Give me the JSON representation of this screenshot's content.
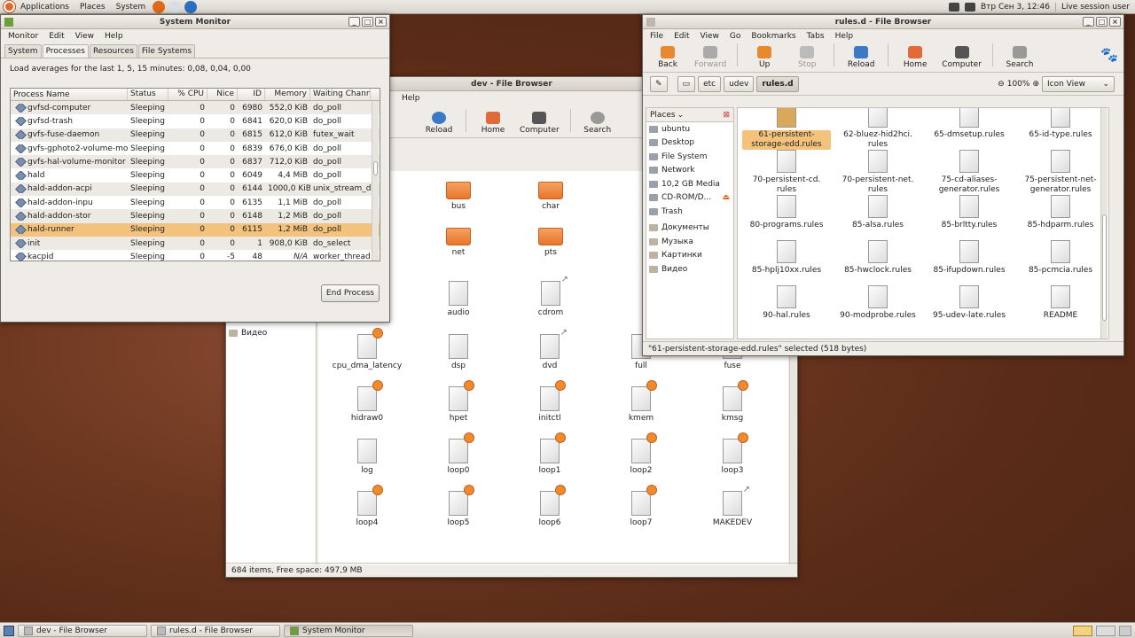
{
  "top_panel": {
    "menus": [
      "Applications",
      "Places",
      "System"
    ],
    "keyboard": "Втр Сен  3, 12:46",
    "session": "Live session user"
  },
  "sysmon": {
    "title": "System Monitor",
    "menus": [
      "Monitor",
      "Edit",
      "View",
      "Help"
    ],
    "tabs": [
      "System",
      "Processes",
      "Resources",
      "File Systems"
    ],
    "load": "Load averages for the last 1, 5, 15 minutes: 0,08, 0,04, 0,00",
    "columns": [
      "Process Name",
      "Status",
      "% CPU",
      "Nice",
      "ID",
      "Memory",
      "Waiting Channe"
    ],
    "rows": [
      {
        "name": "gvfsd-computer",
        "status": "Sleeping",
        "cpu": "0",
        "nice": "0",
        "id": "6980",
        "mem": "552,0 KiB",
        "wait": "do_poll"
      },
      {
        "name": "gvfsd-trash",
        "status": "Sleeping",
        "cpu": "0",
        "nice": "0",
        "id": "6841",
        "mem": "620,0 KiB",
        "wait": "do_poll"
      },
      {
        "name": "gvfs-fuse-daemon",
        "status": "Sleeping",
        "cpu": "0",
        "nice": "0",
        "id": "6815",
        "mem": "612,0 KiB",
        "wait": "futex_wait"
      },
      {
        "name": "gvfs-gphoto2-volume-mon",
        "status": "Sleeping",
        "cpu": "0",
        "nice": "0",
        "id": "6839",
        "mem": "676,0 KiB",
        "wait": "do_poll"
      },
      {
        "name": "gvfs-hal-volume-monitor",
        "status": "Sleeping",
        "cpu": "0",
        "nice": "0",
        "id": "6837",
        "mem": "712,0 KiB",
        "wait": "do_poll"
      },
      {
        "name": "hald",
        "status": "Sleeping",
        "cpu": "0",
        "nice": "0",
        "id": "6049",
        "mem": "4,4 MiB",
        "wait": "do_poll"
      },
      {
        "name": "hald-addon-acpi",
        "status": "Sleeping",
        "cpu": "0",
        "nice": "0",
        "id": "6144",
        "mem": "1000,0 KiB",
        "wait": "unix_stream_da"
      },
      {
        "name": "hald-addon-inpu",
        "status": "Sleeping",
        "cpu": "0",
        "nice": "0",
        "id": "6135",
        "mem": "1,1 MiB",
        "wait": "do_poll"
      },
      {
        "name": "hald-addon-stor",
        "status": "Sleeping",
        "cpu": "0",
        "nice": "0",
        "id": "6148",
        "mem": "1,2 MiB",
        "wait": "do_poll"
      },
      {
        "name": "hald-runner",
        "status": "Sleeping",
        "cpu": "0",
        "nice": "0",
        "id": "6115",
        "mem": "1,2 MiB",
        "wait": "do_poll",
        "selected": true
      },
      {
        "name": "init",
        "status": "Sleeping",
        "cpu": "0",
        "nice": "0",
        "id": "1",
        "mem": "908,0 KiB",
        "wait": "do_select"
      },
      {
        "name": "kacpid",
        "status": "Sleeping",
        "cpu": "0",
        "nice": "-5",
        "id": "48",
        "mem": "N/A",
        "wait": "worker_thread"
      }
    ],
    "end_process": "End Process"
  },
  "devfb": {
    "title": "dev - File Browser",
    "menu_help": "Help",
    "toolbar": [
      "Reload",
      "Home",
      "Computer",
      "Search"
    ],
    "sidebar_item": "Видео",
    "status": "684 items, Free space: 497,9 MB",
    "items": [
      {
        "name": "bus",
        "kind": "folder"
      },
      {
        "name": "char",
        "kind": "folder"
      },
      {
        "name": "net",
        "kind": "folder"
      },
      {
        "name": "pts",
        "kind": "folder"
      },
      {
        "name": "audio",
        "kind": "file"
      },
      {
        "name": "cdrom",
        "kind": "link"
      },
      {
        "name": "cpu_dma_latency",
        "kind": "emb"
      },
      {
        "name": "dsp",
        "kind": "file"
      },
      {
        "name": "dvd",
        "kind": "link"
      },
      {
        "name": "full",
        "kind": "file"
      },
      {
        "name": "fuse",
        "kind": "file"
      },
      {
        "name": "hidraw0",
        "kind": "emb"
      },
      {
        "name": "hpet",
        "kind": "emb"
      },
      {
        "name": "initctl",
        "kind": "emb"
      },
      {
        "name": "kmem",
        "kind": "emb"
      },
      {
        "name": "kmsg",
        "kind": "emb"
      },
      {
        "name": "log",
        "kind": "file"
      },
      {
        "name": "loop0",
        "kind": "emb"
      },
      {
        "name": "loop1",
        "kind": "emb"
      },
      {
        "name": "loop2",
        "kind": "emb"
      },
      {
        "name": "loop3",
        "kind": "emb"
      },
      {
        "name": "loop4",
        "kind": "emb"
      },
      {
        "name": "loop5",
        "kind": "emb"
      },
      {
        "name": "loop6",
        "kind": "emb"
      },
      {
        "name": "loop7",
        "kind": "emb"
      },
      {
        "name": "MAKEDEV",
        "kind": "link"
      }
    ]
  },
  "rulesfb": {
    "title": "rules.d - File Browser",
    "menus": [
      "File",
      "Edit",
      "View",
      "Go",
      "Bookmarks",
      "Tabs",
      "Help"
    ],
    "toolbar": [
      "Back",
      "Forward",
      "Up",
      "Stop",
      "Reload",
      "Home",
      "Computer",
      "Search"
    ],
    "path": [
      "etc",
      "udev",
      "rules.d"
    ],
    "zoom": "100%",
    "view": "Icon View",
    "places_label": "Places",
    "places": [
      "ubuntu",
      "Desktop",
      "File System",
      "Network",
      "10,2 GB Media",
      "CD-ROM/D...",
      "Trash",
      "Документы",
      "Музыка",
      "Картинки",
      "Видео"
    ],
    "files": [
      [
        "61-persistent-",
        "storage-edd.rules"
      ],
      [
        "62-bluez-hid2hci.",
        "rules"
      ],
      [
        "65-dmsetup.rules",
        ""
      ],
      [
        "65-id-type.rules",
        ""
      ],
      [
        "70-persistent-cd.",
        "rules"
      ],
      [
        "70-persistent-net.",
        "rules"
      ],
      [
        "75-cd-aliases-",
        "generator.rules"
      ],
      [
        "75-persistent-net-",
        "generator.rules"
      ],
      [
        "80-programs.rules",
        ""
      ],
      [
        "85-alsa.rules",
        ""
      ],
      [
        "85-brltty.rules",
        ""
      ],
      [
        "85-hdparm.rules",
        ""
      ],
      [
        "85-hplj10xx.rules",
        ""
      ],
      [
        "85-hwclock.rules",
        ""
      ],
      [
        "85-ifupdown.rules",
        ""
      ],
      [
        "85-pcmcia.rules",
        ""
      ],
      [
        "90-hal.rules",
        ""
      ],
      [
        "90-modprobe.rules",
        ""
      ],
      [
        "95-udev-late.rules",
        ""
      ],
      [
        "README",
        ""
      ]
    ],
    "status": "\"61-persistent-storage-edd.rules\" selected (518 bytes)"
  },
  "taskbar": [
    "dev - File Browser",
    "rules.d - File Browser",
    "System Monitor"
  ]
}
